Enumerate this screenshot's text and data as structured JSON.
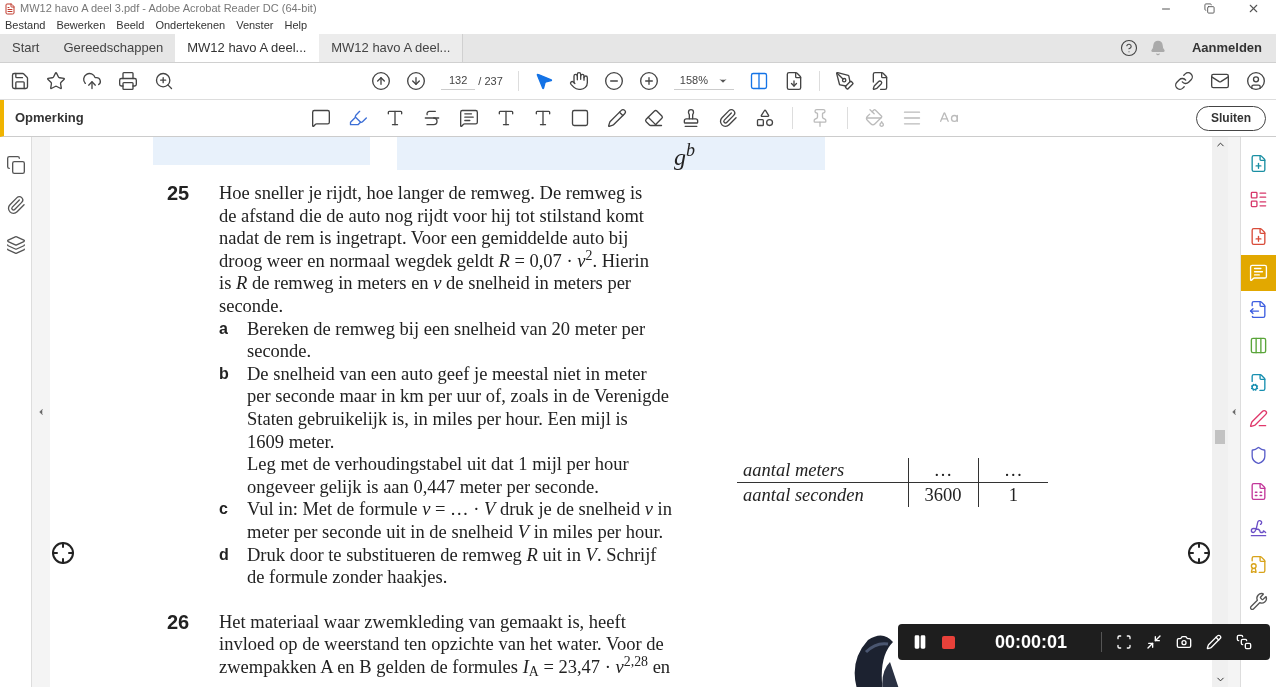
{
  "window": {
    "title": "MW12 havo A deel 3.pdf - Adobe Acrobat Reader DC (64-bit)"
  },
  "menu": [
    "Bestand",
    "Bewerken",
    "Beeld",
    "Ondertekenen",
    "Venster",
    "Help"
  ],
  "tabs": [
    {
      "label": "Start",
      "selected": false
    },
    {
      "label": "Gereedschappen",
      "selected": false
    },
    {
      "label": "MW12 havo A deel...",
      "selected": true
    },
    {
      "label": "MW12 havo A deel...",
      "selected": false
    }
  ],
  "account": {
    "label": "Aanmelden"
  },
  "toolbar": {
    "page": "132",
    "total": "/ 237",
    "zoom": "158%",
    "tools": [
      {
        "kind": "pointer",
        "selected": true
      },
      {
        "kind": "hand",
        "selected": false
      }
    ]
  },
  "comment_bar": {
    "title": "Opmerking",
    "close": "Sluiten"
  },
  "right_panel": [
    {
      "selected": false
    },
    {
      "selected": false
    },
    {
      "selected": false
    },
    {
      "selected": true
    },
    {
      "selected": false
    },
    {
      "selected": false
    },
    {
      "selected": false
    },
    {
      "selected": false
    },
    {
      "selected": false
    },
    {
      "selected": false
    },
    {
      "selected": false
    },
    {
      "selected": false
    },
    {
      "selected": false
    }
  ],
  "document": {
    "fragment": "g$^{b}$",
    "questions": [
      {
        "number": "25",
        "lines": [
          "Hoe sneller je rijdt, hoe langer de remweg. De remweg is",
          "de afstand die de auto nog rijdt voor hij tot stilstand komt",
          "nadat de rem is ingetrapt. Voor een gemiddelde auto bij",
          "droog weer en normaal wegdek geldt *R* = 0,07 · *v*$^{2}$. Hierin",
          "is *R* de remweg in meters en *v* de snelheid in meters per",
          "seconde."
        ],
        "parts": [
          {
            "letter": "a",
            "lines": [
              "Bereken de remweg bij een snelheid van 20 meter per",
              "seconde."
            ]
          },
          {
            "letter": "b",
            "lines": [
              "De snelheid van een auto geef je meestal niet in meter",
              "per seconde maar in km per uur of, zoals in de Verenigde",
              "Staten gebruikelijk is, in miles per hour. Een mijl is",
              "1609 meter.",
              "Leg met de verhoudingstabel uit dat 1 mijl per hour",
              "ongeveer gelijk is aan 0,447 meter per seconde."
            ]
          },
          {
            "letter": "c",
            "lines": [
              "Vul in: Met de formule *v* = … · *V* druk je de snelheid *v* in",
              "meter per seconde uit in de snelheid *V* in miles per hour."
            ]
          },
          {
            "letter": "d",
            "lines": [
              "Druk door te substitueren de remweg *R* uit in *V*. Schrijf",
              "de formule zonder haakjes."
            ]
          }
        ],
        "table": {
          "rows": [
            [
              "aantal meters",
              "…",
              "…"
            ],
            [
              "aantal seconden",
              "3600",
              "1"
            ]
          ]
        }
      },
      {
        "number": "26",
        "lines": [
          "Het materiaal waar zwemkleding van gemaakt is, heeft",
          "invloed op de weerstand ten opzichte van het water. Voor de",
          "zwempakken A en B gelden de formules *I*$_{A}$ = 23,47 · *v*$^{2,28}$ en"
        ]
      }
    ]
  },
  "recorder": {
    "time": "00:00:01"
  }
}
